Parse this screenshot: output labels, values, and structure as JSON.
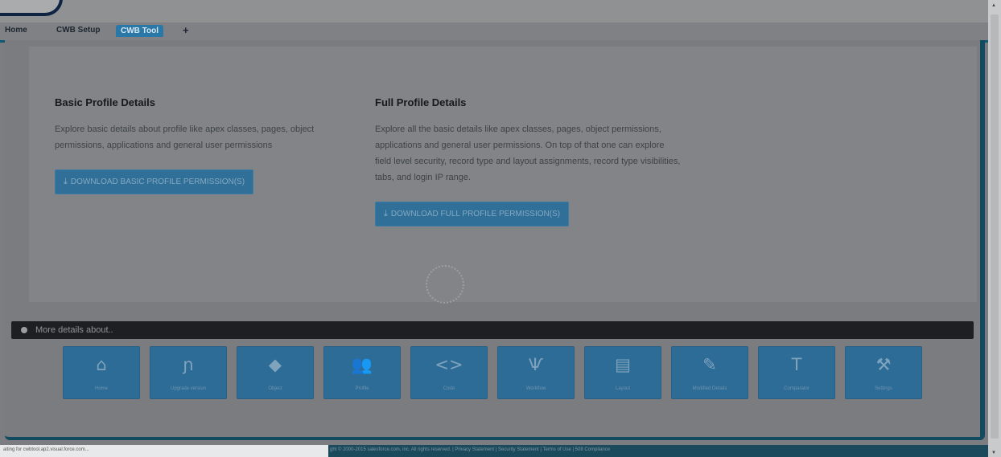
{
  "tabs": [
    "Home",
    "CWB Setup",
    "CWB Tool",
    "+"
  ],
  "basic": {
    "title": "Basic Profile Details",
    "desc": "Explore basic details about profile like apex classes, pages, object permissions, applications and general user permissions",
    "button": "DOWNLOAD BASIC PROFILE PERMISSION(S)"
  },
  "full": {
    "title": "Full Profile Details",
    "desc": "Explore all the basic details like apex classes, pages, object permissions, applications and general user permissions. On top of that one can explore field level security, record type and layout assignments, record type visibilities, tabs, and login IP range.",
    "button": "DOWNLOAD FULL PROFILE PERMISSION(S)"
  },
  "more_details": "More details about..",
  "tiles": [
    {
      "label": "Home",
      "icon": "home-icon",
      "glyph": "⌂"
    },
    {
      "label": "Upgrade version",
      "icon": "upgrade-icon",
      "glyph": "ɲ"
    },
    {
      "label": "Object",
      "icon": "cube-icon",
      "glyph": "◆"
    },
    {
      "label": "Profile",
      "icon": "users-icon",
      "glyph": "👥"
    },
    {
      "label": "Code",
      "icon": "code-icon",
      "glyph": "<>"
    },
    {
      "label": "Workflow",
      "icon": "workflow-icon",
      "glyph": "Ѱ"
    },
    {
      "label": "Layout",
      "icon": "layout-icon",
      "glyph": "▤"
    },
    {
      "label": "Modified Details",
      "icon": "pencil-icon",
      "glyph": "✎"
    },
    {
      "label": "Comparator",
      "icon": "text-icon",
      "glyph": "T"
    },
    {
      "label": "Settings",
      "icon": "tools-icon",
      "glyph": "⚒"
    }
  ],
  "status": "aiting for cwbtool.ap2.visual.force.com...",
  "footer": "ght © 2000-2015 salesforce.com, inc. All rights reserved. | Privacy Statement | Security Statement | Terms of Use | 508 Compliance"
}
